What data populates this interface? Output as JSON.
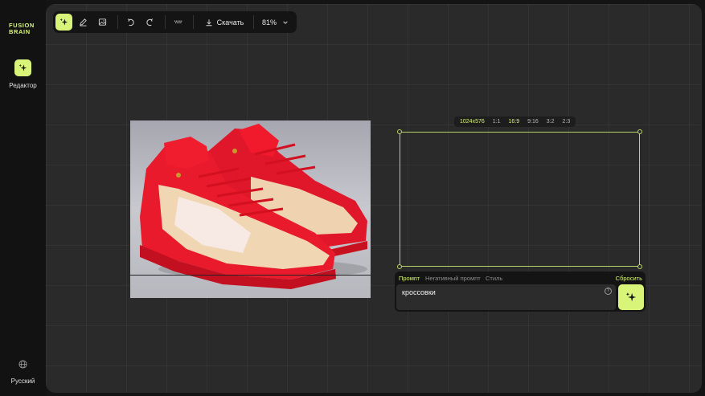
{
  "app": {
    "logo_line1": "FUSION",
    "logo_line2": "BRAIN",
    "accent_color": "#d8f57a"
  },
  "sidebar": {
    "editor_label": "Редактор",
    "language_label": "Русский"
  },
  "toolbar": {
    "download_label": "Скачать",
    "zoom_label": "81%"
  },
  "ratios": {
    "size_label": "1024x576",
    "options": [
      "1:1",
      "16:9",
      "9:16",
      "3:2",
      "2:3"
    ],
    "selected": "16:9"
  },
  "prompt_panel": {
    "tabs": [
      "Промпт",
      "Негативный промпт",
      "Стиль"
    ],
    "selected_tab": "Промпт",
    "reset_label": "Сбросить",
    "prompt_value": "кроссовки",
    "help_symbol": "?"
  }
}
